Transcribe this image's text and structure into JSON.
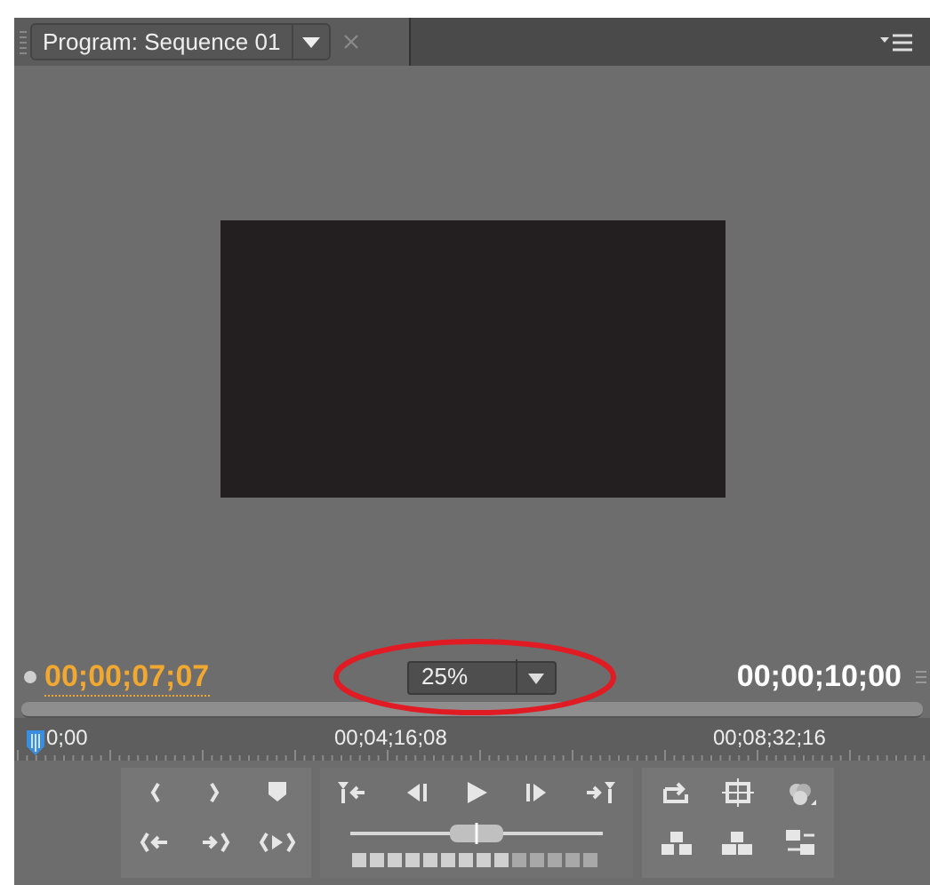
{
  "tab": {
    "label": "Program: Sequence 01"
  },
  "timecodes": {
    "current": "00;00;07;07",
    "duration": "00;00;10;00"
  },
  "zoom": {
    "value": "25%"
  },
  "shuttle": {
    "level": 0.5
  },
  "ruler": {
    "labels": [
      "0;00",
      "00;04;16;08",
      "00;08;32;16"
    ]
  }
}
